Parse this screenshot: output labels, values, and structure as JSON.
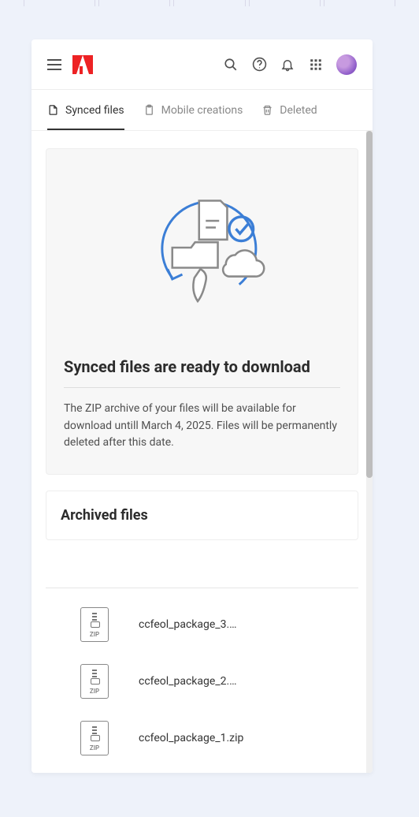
{
  "tabs": {
    "synced": "Synced files",
    "mobile": "Mobile creations",
    "deleted": "Deleted"
  },
  "infoCard": {
    "title": "Synced files are ready to download",
    "body": "The ZIP archive of your files will be available for download untill March 4, 2025. Files will be permanently deleted after this date."
  },
  "archivedSection": {
    "title": "Archived files"
  },
  "files": [
    {
      "name": "ccfeol_package_3.…",
      "type": "ZIP"
    },
    {
      "name": "ccfeol_package_2.…",
      "type": "ZIP"
    },
    {
      "name": "ccfeol_package_1.zip",
      "type": "ZIP"
    }
  ]
}
